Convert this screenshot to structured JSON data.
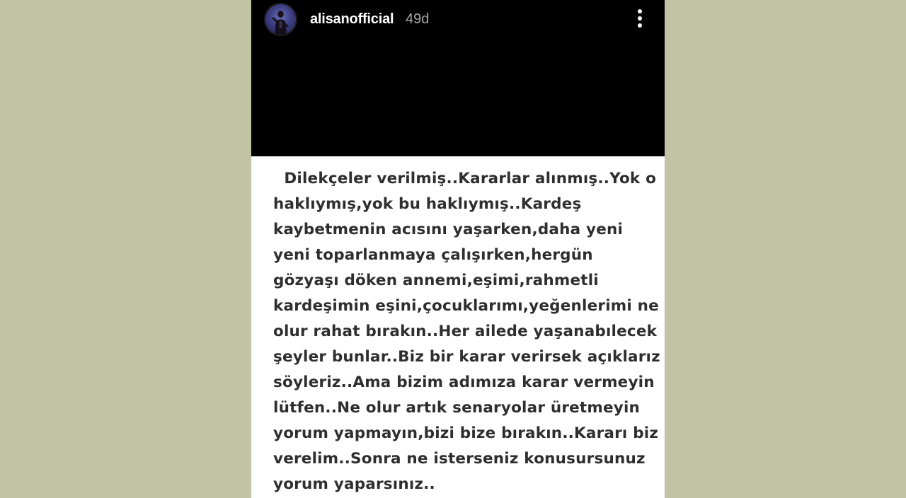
{
  "post": {
    "username": "alisanofficial",
    "time": "49d",
    "avatar_icon": "profile-avatar",
    "more_icon": "more-vertical-icon"
  },
  "caption": {
    "lines": [
      "  Dilekçeler verilmiş..Kararlar alınmış..Yok o",
      "haklıymış,yok bu haklıymış..Kardeş",
      "kaybetmenin acısını yaşarken,daha yeni",
      "yeni toparlanmaya çalışırken,hergün",
      "gözyaşı döken annemi,eşimi,rahmetli",
      "kardeşimin eşini,çocuklarımı,yeğenlerimi ne",
      "olur rahat bırakın..Her ailede yaşanabılecek",
      "şeyler bunlar..Biz bir karar verirsek açıklarız",
      "söyleriz..Ama bizim adımıza karar vermeyin",
      "lütfen..Ne olur artık senaryolar üretmeyin",
      "yorum yapmayın,bizi bize bırakın..Kararı biz",
      "verelim..Sonra ne isterseniz konusursunuz",
      "yorum yaparsınız.."
    ]
  },
  "colors": {
    "page_background": "#c2c2a4",
    "header_background": "#000000",
    "caption_text": "#2e2e2e",
    "time_text": "#a9a9a9"
  }
}
